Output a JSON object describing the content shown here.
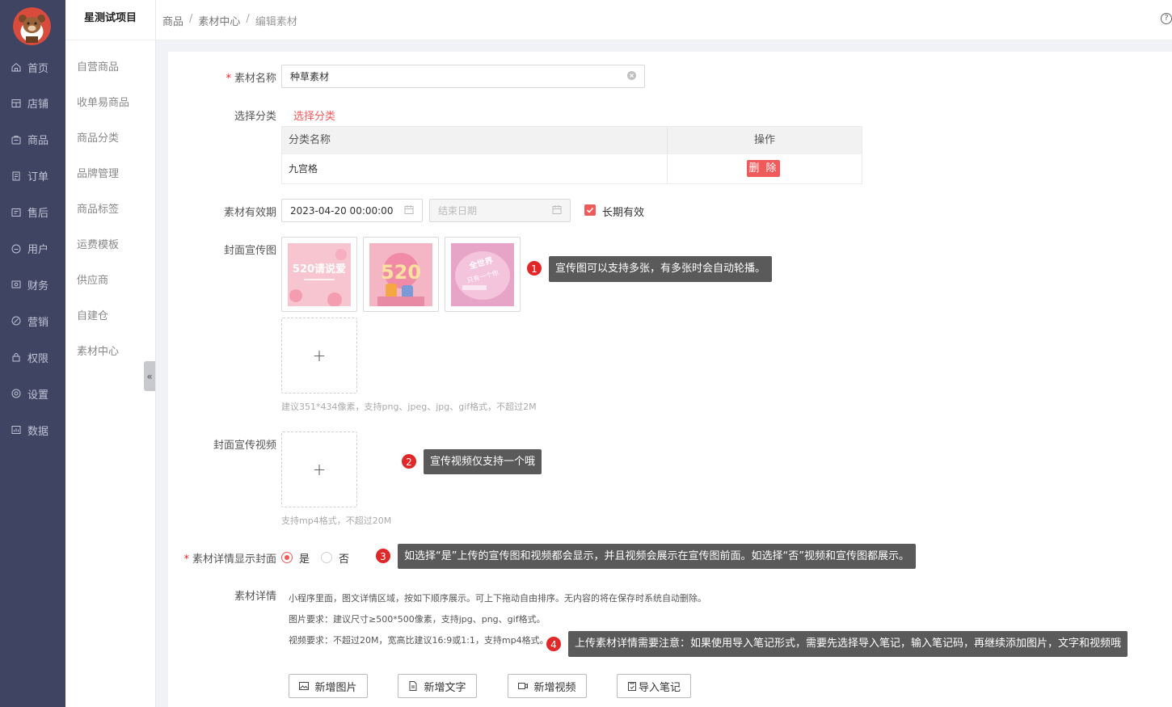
{
  "project_name": "星测试项目",
  "nav": {
    "items": [
      {
        "label": "首页",
        "icon": "home-icon"
      },
      {
        "label": "店铺",
        "icon": "shop-icon"
      },
      {
        "label": "商品",
        "icon": "goods-icon"
      },
      {
        "label": "订单",
        "icon": "order-icon"
      },
      {
        "label": "售后",
        "icon": "aftersale-icon"
      },
      {
        "label": "用户",
        "icon": "user-icon"
      },
      {
        "label": "财务",
        "icon": "finance-icon"
      },
      {
        "label": "营销",
        "icon": "marketing-icon"
      },
      {
        "label": "权限",
        "icon": "lock-icon"
      },
      {
        "label": "设置",
        "icon": "settings-icon"
      },
      {
        "label": "数据",
        "icon": "data-icon"
      }
    ]
  },
  "subnav": {
    "items": [
      "自营商品",
      "收单易商品",
      "商品分类",
      "品牌管理",
      "商品标签",
      "运费模板",
      "供应商",
      "自建仓",
      "素材中心"
    ]
  },
  "breadcrumb": [
    "商品",
    "素材中心",
    "编辑素材"
  ],
  "form": {
    "name_label": "素材名称",
    "name_value": "种草素材",
    "category_label": "选择分类",
    "category_link": "选择分类",
    "table": {
      "headers": [
        "分类名称",
        "操作"
      ],
      "rows": [
        {
          "name": "九宫格",
          "action": "删 除"
        }
      ]
    },
    "validity_label": "素材有效期",
    "start_date": "2023-04-20 00:00:00",
    "end_placeholder": "结束日期",
    "long_term_label": "长期有效",
    "long_term_checked": true,
    "cover_label": "封面宣传图",
    "cover_images": [
      {
        "text": "520请说爱",
        "name": "cover-image-1"
      },
      {
        "text": "520",
        "name": "cover-image-2"
      },
      {
        "text": "全世界只有一个你",
        "name": "cover-image-3"
      }
    ],
    "cover_hint": "建议351*434像素，支持png、jpeg、jpg、gif格式，不超过2M",
    "video_label": "封面宣传视频",
    "video_hint": "支持mp4格式，不超过20M",
    "show_cover_label": "素材详情显示封面",
    "show_cover_yes": "是",
    "show_cover_no": "否",
    "show_cover_selected": "是",
    "detail_label": "素材详情",
    "detail_notes": [
      "小程序里面，图文详情区域，按如下顺序展示。可上下拖动自由排序。无内容的将在保存时系统自动删除。",
      "图片要求：建议尺寸≥500*500像素，支持jpg、png、gif格式。",
      "视频要求：不超过20M，宽高比建议16:9或1:1，支持mp4格式。"
    ],
    "buttons": {
      "add_image": "新增图片",
      "add_text": "新增文字",
      "add_video": "新增视频",
      "import_note": "导入笔记"
    }
  },
  "tips": [
    {
      "num": "1",
      "text": "宣传图可以支持多张，有多张时会自动轮播。"
    },
    {
      "num": "2",
      "text": "宣传视频仅支持一个哦"
    },
    {
      "num": "3",
      "text": "如选择“是”上传的宣传图和视频都会显示，并且视频会展示在宣传图前面。如选择“否”视频和宣传图都展示。"
    },
    {
      "num": "4",
      "text": "上传素材详情需要注意：如果使用导入笔记形式，需要先选择导入笔记，输入笔记码，再继续添加图片，文字和视频哦"
    }
  ],
  "colors": {
    "nav_bg": "#3f4463",
    "accent": "#ef5b5b",
    "tip_bg": "#5a5a5a",
    "badge": "#e02828"
  }
}
